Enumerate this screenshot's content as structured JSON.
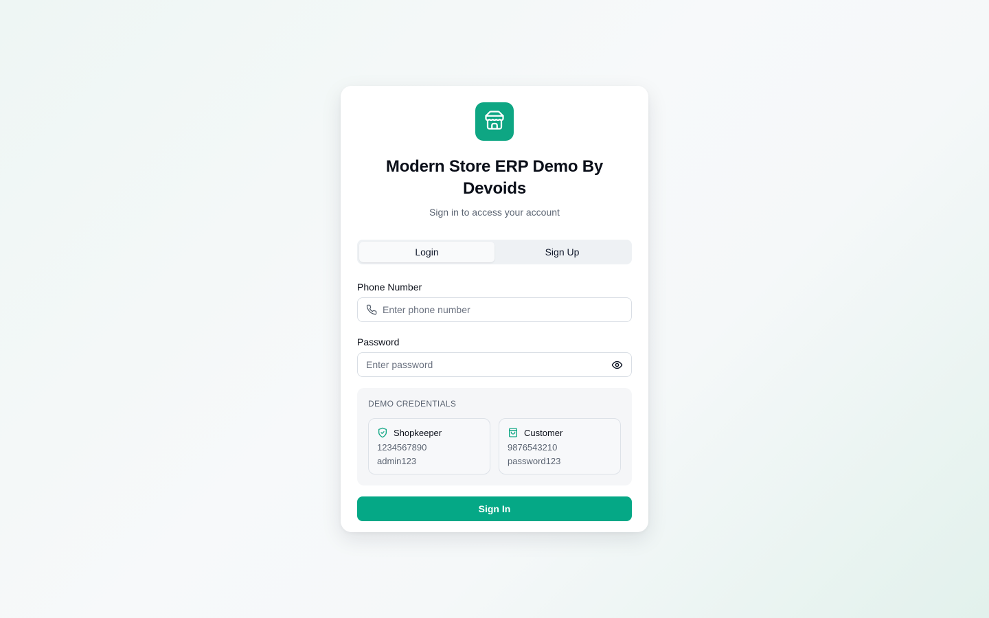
{
  "header": {
    "title": "Modern Store ERP Demo By Devoids",
    "subtitle": "Sign in to access your account"
  },
  "logo_icon": "store-icon",
  "tabs": [
    {
      "label": "Login",
      "active": true
    },
    {
      "label": "Sign Up",
      "active": false
    }
  ],
  "form": {
    "phone": {
      "label": "Phone Number",
      "placeholder": "Enter phone number",
      "icon": "phone-icon"
    },
    "password": {
      "label": "Password",
      "placeholder": "Enter password",
      "icon": "eye-icon"
    }
  },
  "demo": {
    "title": "DEMO CREDENTIALS",
    "shopkeeper": {
      "name": "Shopkeeper",
      "phone": "1234567890",
      "password": "admin123",
      "icon": "shield-check-icon"
    },
    "customer": {
      "name": "Customer",
      "phone": "9876543210",
      "password": "password123",
      "icon": "shopping-bag-icon"
    }
  },
  "submit_label": "Sign In",
  "colors": {
    "accent": "#0ea683",
    "button": "#05a886"
  }
}
